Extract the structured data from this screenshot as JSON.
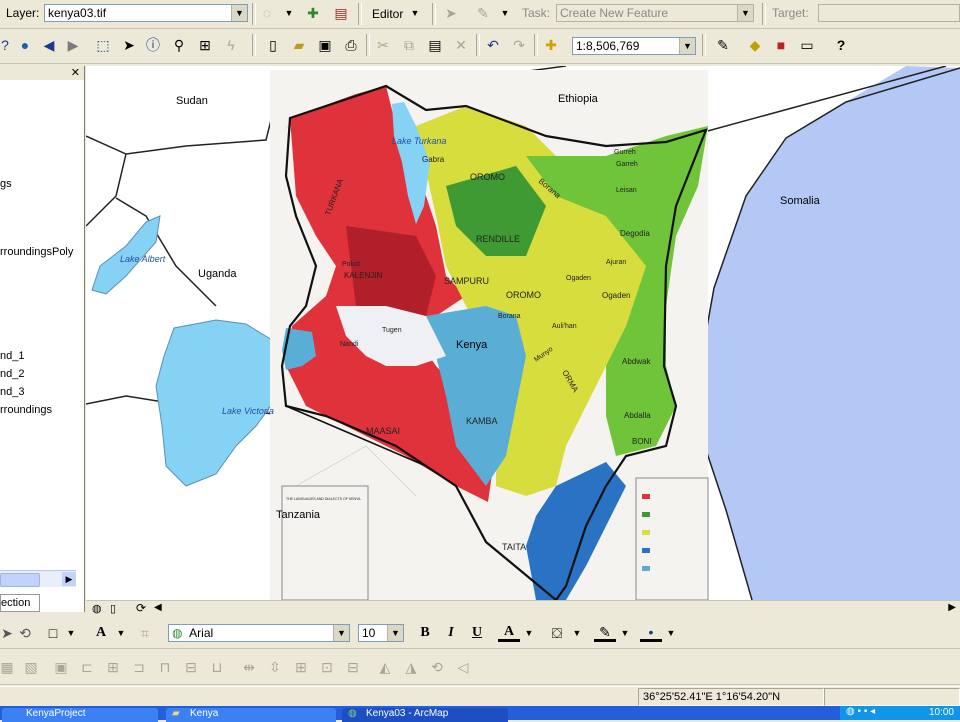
{
  "editor_toolbar": {
    "layer_label": "Layer:",
    "layer_value": "kenya03.tif",
    "editor_label": "Editor",
    "task_label": "Task:",
    "task_value": "Create New Feature",
    "target_label": "Target:",
    "target_value": ""
  },
  "standard_toolbar": {
    "scale_value": "1:8,506,769",
    "help_label": "?"
  },
  "toc": {
    "items": [
      "gs",
      "rroundingsPoly",
      "nd_1",
      "nd_2",
      "nd_3",
      "rroundings"
    ],
    "tab_label": "ection"
  },
  "map": {
    "labels": {
      "sudan": "Sudan",
      "ethiopia": "Ethiopia",
      "somalia": "Somalia",
      "uganda": "Uganda",
      "tanzania": "Tanzania",
      "kenya": "Kenya",
      "lake_albert": "Lake Albert",
      "lake_victoria": "Lake Victoria",
      "lake_turkana": "Lake Turkana"
    },
    "scan_labels": {
      "turkana": "TURKANA",
      "gabra": "Gabra",
      "oromo_north": "OROMO",
      "borana": "Borana",
      "rendille": "RENDILLE",
      "samburu": "SAMPURU",
      "kalenjin": "KALENJIN",
      "oromo_mid": "OROMO",
      "ogaden": "Ogaden",
      "degodia": "Degodia",
      "abdwak": "Abdwak",
      "abdalla": "Abdalla",
      "maasai": "MAASAI",
      "kamba": "KAMBA",
      "taita": "TAITA",
      "boni": "BONI",
      "pokot": "Pokot",
      "ajuran": "Ajuran",
      "garreh": "Garreh",
      "leisan": "Leisan",
      "gurreh": "Gurreh",
      "aulihan": "Auli'han",
      "orma": "ORMA",
      "munyo": "Munyo",
      "tugen": "Tugen",
      "nandi": "Nandi",
      "boran": "Borana",
      "ogaden_small": "Ogaden",
      "legend_title": "THE LANGUAGES AND DIALECTS OF KENYA"
    }
  },
  "drawing_toolbar": {
    "font_name": "Arial",
    "font_size": "10",
    "bold": "B",
    "italic": "I",
    "underline": "U",
    "text_color": "A"
  },
  "status_bar": {
    "coordinates": "36°25'52.41\"E  1°16'54.20\"N"
  },
  "taskbar": {
    "items": [
      "KenyaProject",
      "Kenya",
      "Kenya03 - ArcMap"
    ],
    "clock": "10:00"
  },
  "colors": {
    "background": "#ece9d8",
    "water": "#b4c8f5",
    "lake": "#86d2f5",
    "land": "#ffffff",
    "red_zone": "#e0323a",
    "yellow_zone": "#d8dd3e",
    "green_zone": "#6fc43a",
    "blue_zone": "#5aaed6",
    "coast_blue": "#2a73c4"
  }
}
